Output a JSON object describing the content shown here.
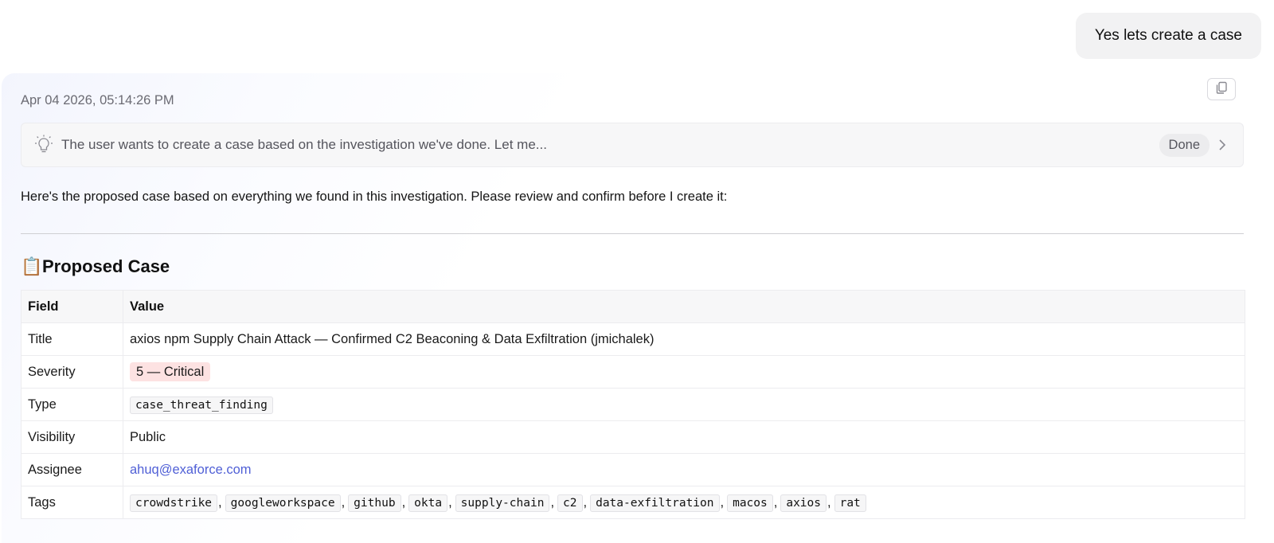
{
  "user_message": "Yes lets create a case",
  "assistant": {
    "timestamp": "Apr 04 2026, 05:14:26 PM",
    "thinking": {
      "summary": "The user wants to create a case based on the investigation we've done. Let me...",
      "status": "Done"
    },
    "intro": "Here's the proposed case based on everything we found in this investigation. Please review and confirm before I create it:",
    "heading_emoji": "📋",
    "heading": "Proposed Case",
    "table": {
      "headers": [
        "Field",
        "Value"
      ],
      "rows": {
        "title": {
          "field": "Title",
          "value": "axios npm Supply Chain Attack — Confirmed C2 Beaconing & Data Exfiltration (jmichalek)"
        },
        "severity": {
          "field": "Severity",
          "value": "5 — Critical"
        },
        "type": {
          "field": "Type",
          "value": "case_threat_finding"
        },
        "visibility": {
          "field": "Visibility",
          "value": "Public"
        },
        "assignee": {
          "field": "Assignee",
          "value": "ahuq@exaforce.com"
        },
        "tags": {
          "field": "Tags",
          "values": [
            "crowdstrike",
            "googleworkspace",
            "github",
            "okta",
            "supply-chain",
            "c2",
            "data-exfiltration",
            "macos",
            "axios",
            "rat"
          ]
        }
      }
    }
  },
  "icons": {
    "copy": "copy-icon",
    "thinking": "lightbulb-icon",
    "expand": "chevron-right-icon"
  },
  "colors": {
    "severity_badge_bg": "#fde2e2",
    "link": "#4f5fd6"
  }
}
